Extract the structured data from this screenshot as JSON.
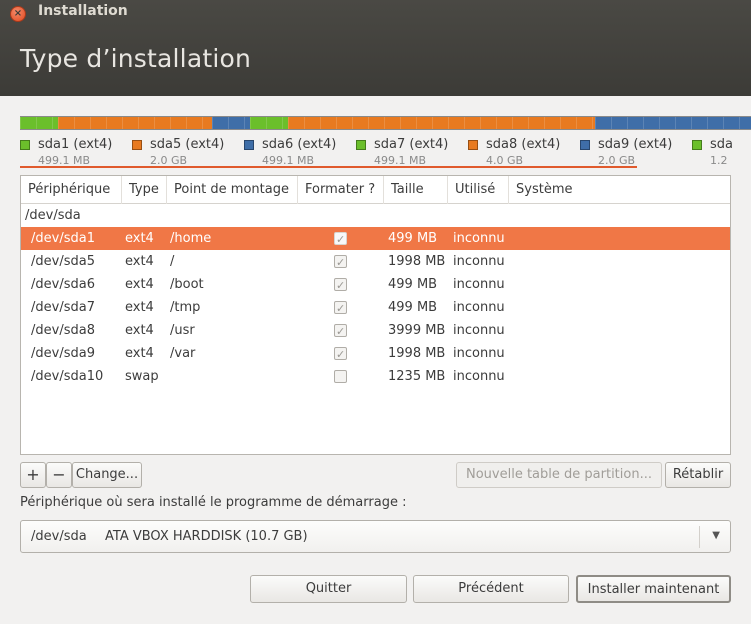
{
  "window": {
    "app_title": "Installation",
    "page_title": "Type d’installation"
  },
  "partition_bar": {
    "segments": [
      {
        "color": "#6bbf2b",
        "fraction": 0.052
      },
      {
        "color": "#e87a20",
        "fraction": 0.21
      },
      {
        "color": "#3f6ea8",
        "fraction": 0.052
      },
      {
        "color": "#6bbf2b",
        "fraction": 0.052
      },
      {
        "color": "#e87a20",
        "fraction": 0.42
      },
      {
        "color": "#3f6ea8",
        "fraction": 0.214
      }
    ]
  },
  "legend": [
    {
      "name": "sda1 (ext4)",
      "size": "499.1 MB",
      "color": "#6bbf2b"
    },
    {
      "name": "sda5 (ext4)",
      "size": "2.0 GB",
      "color": "#e87a20"
    },
    {
      "name": "sda6 (ext4)",
      "size": "499.1 MB",
      "color": "#3f6ea8"
    },
    {
      "name": "sda7 (ext4)",
      "size": "499.1 MB",
      "color": "#6bbf2b"
    },
    {
      "name": "sda8 (ext4)",
      "size": "4.0 GB",
      "color": "#e87a20"
    },
    {
      "name": "sda9 (ext4)",
      "size": "2.0 GB",
      "color": "#3f6ea8"
    },
    {
      "name": "sda",
      "size": "1.2",
      "color": "#6bbf2b"
    }
  ],
  "table": {
    "columns": [
      "Périphérique",
      "Type",
      "Point de montage",
      "Formater ?",
      "Taille",
      "Utilisé",
      "Système"
    ],
    "group_label": "/dev/sda",
    "rows": [
      {
        "device": "/dev/sda1",
        "type": "ext4",
        "mount": "/home",
        "format": true,
        "size": "499 MB",
        "used": "inconnu",
        "system": "",
        "selected": true
      },
      {
        "device": "/dev/sda5",
        "type": "ext4",
        "mount": "/",
        "format": true,
        "size": "1998 MB",
        "used": "inconnu",
        "system": ""
      },
      {
        "device": "/dev/sda6",
        "type": "ext4",
        "mount": "/boot",
        "format": true,
        "size": "499 MB",
        "used": "inconnu",
        "system": ""
      },
      {
        "device": "/dev/sda7",
        "type": "ext4",
        "mount": "/tmp",
        "format": true,
        "size": "499 MB",
        "used": "inconnu",
        "system": ""
      },
      {
        "device": "/dev/sda8",
        "type": "ext4",
        "mount": "/usr",
        "format": true,
        "size": "3999 MB",
        "used": "inconnu",
        "system": ""
      },
      {
        "device": "/dev/sda9",
        "type": "ext4",
        "mount": "/var",
        "format": true,
        "size": "1998 MB",
        "used": "inconnu",
        "system": ""
      },
      {
        "device": "/dev/sda10",
        "type": "swap",
        "mount": "",
        "format": false,
        "size": "1235 MB",
        "used": "inconnu",
        "system": ""
      }
    ]
  },
  "toolbar": {
    "add_label": "+",
    "remove_label": "−",
    "change_label": "Change...",
    "new_table_label": "Nouvelle table de partition...",
    "revert_label": "Rétablir"
  },
  "bootloader": {
    "label": "Périphérique où sera installé le programme de démarrage :",
    "selected_device": "/dev/sda",
    "selected_desc": "ATA VBOX HARDDISK (10.7 GB)"
  },
  "actions": {
    "quit_label": "Quitter",
    "back_label": "Précédent",
    "install_label": "Installer maintenant"
  },
  "icons": {
    "close": "close-icon",
    "dropdown": "chevron-down-icon"
  }
}
